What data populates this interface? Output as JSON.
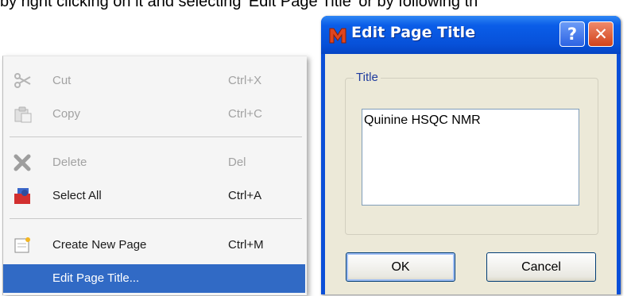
{
  "instruction_text": "by right clicking on it and selecting 'Edit Page Title' or by following th",
  "context_menu": {
    "items": [
      {
        "label": "Cut",
        "shortcut": "Ctrl+X",
        "icon": "scissors-icon",
        "enabled": false
      },
      {
        "label": "Copy",
        "shortcut": "Ctrl+C",
        "icon": "copy-icon",
        "enabled": false
      },
      {
        "label": "Delete",
        "shortcut": "Del",
        "icon": "delete-x-icon",
        "enabled": false
      },
      {
        "label": "Select All",
        "shortcut": "Ctrl+A",
        "icon": "select-all-icon",
        "enabled": true
      },
      {
        "label": "Create New Page",
        "shortcut": "Ctrl+M",
        "icon": "new-page-icon",
        "enabled": true
      },
      {
        "label": "Edit Page Title...",
        "shortcut": "",
        "icon": "",
        "enabled": true,
        "highlighted": true
      }
    ]
  },
  "dialog": {
    "title": "Edit Page Title",
    "app_icon": "mnova-logo-icon",
    "help_label": "?",
    "close_label": "✕",
    "group_label": "Title",
    "title_value": "Quinine HSQC NMR",
    "ok_label": "OK",
    "cancel_label": "Cancel"
  },
  "colors": {
    "highlight": "#316ac5",
    "titlebar": "#0a5de8",
    "dialog_bg": "#ece9d8",
    "disabled_text": "#a2a2a2",
    "group_label": "#1f3c9e"
  }
}
